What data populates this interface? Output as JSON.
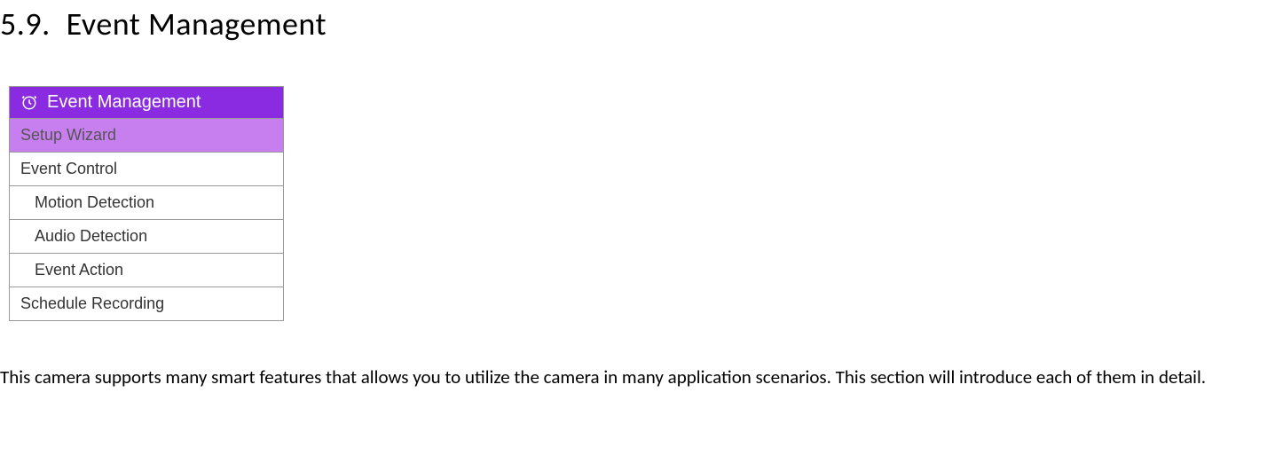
{
  "heading": {
    "number": "5.9.",
    "title": "Event Management"
  },
  "menu": {
    "header": {
      "label": "Event Management",
      "iconName": "alert-clock-icon"
    },
    "items": [
      {
        "label": "Setup Wizard",
        "selected": true,
        "sub": false
      },
      {
        "label": "Event Control",
        "selected": false,
        "sub": false
      },
      {
        "label": "Motion Detection",
        "selected": false,
        "sub": true
      },
      {
        "label": "Audio Detection",
        "selected": false,
        "sub": true
      },
      {
        "label": "Event Action",
        "selected": false,
        "sub": true
      },
      {
        "label": "Schedule Recording",
        "selected": false,
        "sub": false
      }
    ]
  },
  "body_text": "This camera supports many smart features that allows you to utilize the camera in many application scenarios. This section will introduce each of them in detail."
}
